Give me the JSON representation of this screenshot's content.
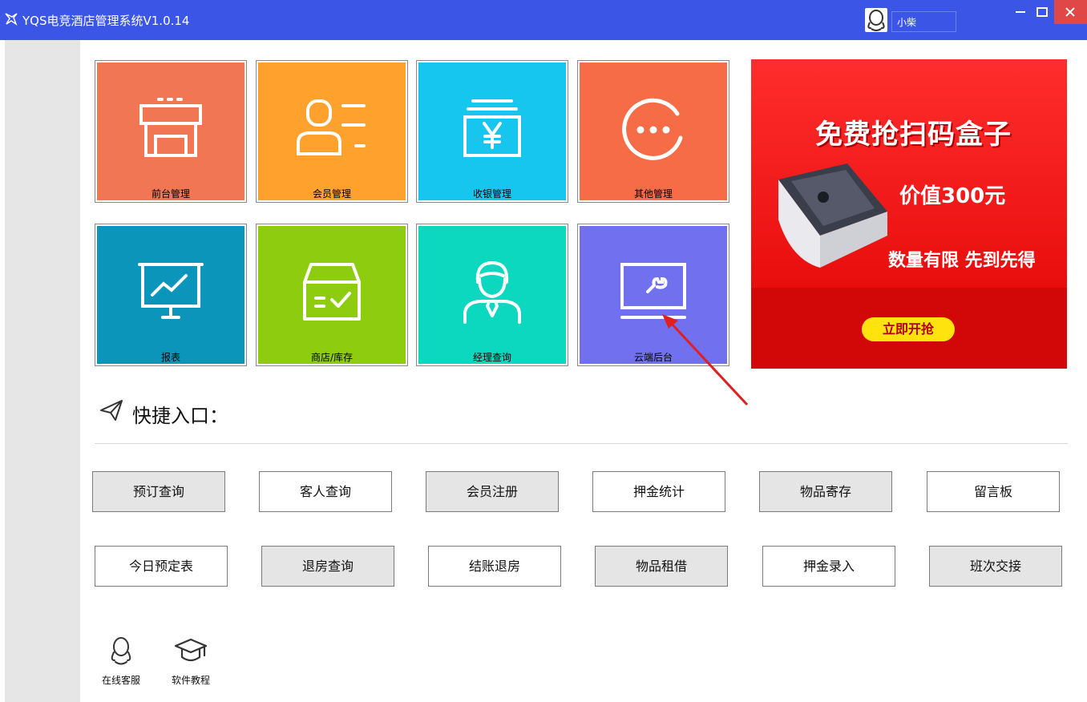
{
  "titlebar": {
    "title": "YQS电竞酒店管理系统V1.0.14",
    "username": "小柴",
    "color": "#3b55e6"
  },
  "tiles": [
    {
      "label": "前台管理",
      "color": "#f17653",
      "icon": "storefront-icon"
    },
    {
      "label": "会员管理",
      "color": "#fea12d",
      "icon": "member-card-icon"
    },
    {
      "label": "收银管理",
      "color": "#17c6ee",
      "icon": "cashier-yen-icon"
    },
    {
      "label": "其他管理",
      "color": "#f56c47",
      "icon": "more-dots-icon"
    },
    {
      "label": "报表",
      "color": "#0b95bb",
      "icon": "report-chart-icon"
    },
    {
      "label": "商店/库存",
      "color": "#8dcc0e",
      "icon": "store-box-icon"
    },
    {
      "label": "经理查询",
      "color": "#0cd8c0",
      "icon": "manager-icon"
    },
    {
      "label": "云端后台",
      "color": "#7170ee",
      "icon": "cloud-monitor-icon"
    }
  ],
  "banner": {
    "title": "免费抢扫码盒子",
    "value": "价值300元",
    "slogan": "数量有限 先到先得",
    "cta": "立即开抢"
  },
  "quick_entry": {
    "title": "快捷入口：",
    "row1": [
      "预订查询",
      "客人查询",
      "会员注册",
      "押金统计",
      "物品寄存",
      "留言板"
    ],
    "row2": [
      "今日预定表",
      "退房查询",
      "结账退房",
      "物品租借",
      "押金录入",
      "班次交接"
    ]
  },
  "bottom_links": [
    {
      "label": "在线客服",
      "icon": "qq-penguin-icon"
    },
    {
      "label": "软件教程",
      "icon": "graduation-cap-icon"
    }
  ]
}
